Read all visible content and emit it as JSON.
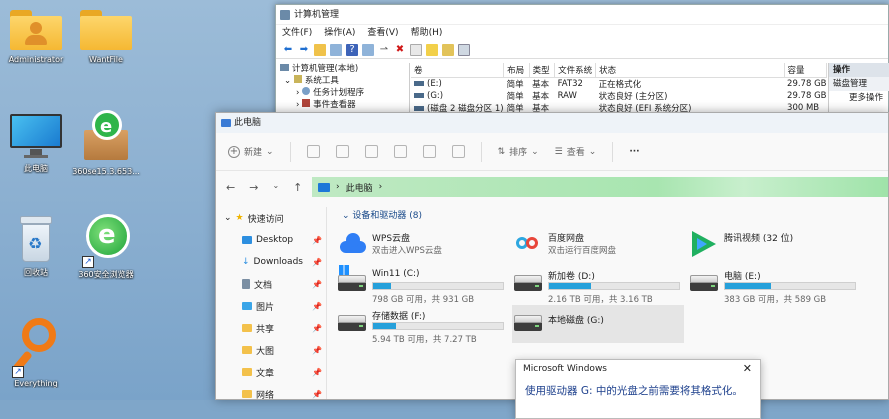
{
  "desktop": {
    "icons": [
      {
        "label": "Administrator"
      },
      {
        "label": "WantFile"
      },
      {
        "label": "此电脑"
      },
      {
        "label": "360se15.3.653..."
      },
      {
        "label": "回收站"
      },
      {
        "label": "360安全浏览器"
      },
      {
        "label": "Everything"
      }
    ]
  },
  "mmc": {
    "title": "计算机管理",
    "menu": [
      "文件(F)",
      "操作(A)",
      "查看(V)",
      "帮助(H)"
    ],
    "tree": [
      "计算机管理(本地)",
      "系统工具",
      "任务计划程序",
      "事件查看器"
    ],
    "volume_headers": [
      "卷",
      "布局",
      "类型",
      "文件系统",
      "状态",
      "容量"
    ],
    "volumes": [
      {
        "name": "(E:)",
        "layout": "简单",
        "type": "基本",
        "fs": "FAT32",
        "status": "正在格式化",
        "size": "29.78 GB"
      },
      {
        "name": "(G:)",
        "layout": "简单",
        "type": "基本",
        "fs": "RAW",
        "status": "状态良好 (主分区)",
        "size": "29.78 GB"
      },
      {
        "name": "(磁盘 2 磁盘分区 1)",
        "layout": "简单",
        "type": "基本",
        "fs": "",
        "status": "状态良好 (EFI 系统分区)",
        "size": "300 MB"
      }
    ],
    "actions_header": "操作",
    "actions_item": "磁盘管理",
    "actions_more": "更多操作"
  },
  "explorer": {
    "title": "此电脑",
    "cmd": {
      "new": "新建",
      "sort": "排序",
      "view": "查看",
      "more": "···"
    },
    "address": "此电脑",
    "nav": [
      {
        "label": "快速访问",
        "icon": "star-icon"
      },
      {
        "label": "Desktop",
        "icon": "desktop-icon"
      },
      {
        "label": "Downloads",
        "icon": "download-icon"
      },
      {
        "label": "文档",
        "icon": "document-icon"
      },
      {
        "label": "图片",
        "icon": "picture-icon"
      },
      {
        "label": "共享",
        "icon": "folder-icon"
      },
      {
        "label": "大图",
        "icon": "folder-icon"
      },
      {
        "label": "文章",
        "icon": "folder-icon"
      },
      {
        "label": "网络",
        "icon": "folder-icon"
      }
    ],
    "group_title": "设备和驱动器 (8)",
    "cloud": [
      {
        "name": "WPS云盘",
        "sub": "双击进入WPS云盘"
      },
      {
        "name": "百度网盘",
        "sub": "双击运行百度网盘"
      },
      {
        "name": "腾讯视频 (32 位)",
        "sub": ""
      }
    ],
    "drives": [
      {
        "name": "Win11 (C:)",
        "free": "798 GB 可用，共 931 GB",
        "used_fraction": 0.14
      },
      {
        "name": "新加卷 (D:)",
        "free": "2.16 TB 可用，共 3.16 TB",
        "used_fraction": 0.32
      },
      {
        "name": "电脑 (E:)",
        "free": "383 GB 可用，共 589 GB",
        "used_fraction": 0.35
      },
      {
        "name": "存储数据 (F:)",
        "free": "5.94 TB 可用，共 7.27 TB",
        "used_fraction": 0.18
      },
      {
        "name": "本地磁盘 (G:)",
        "free": "",
        "used_fraction": 0
      }
    ]
  },
  "dialog": {
    "title": "Microsoft Windows",
    "close": "✕",
    "message": "使用驱动器 G: 中的光盘之前需要将其格式化。"
  }
}
